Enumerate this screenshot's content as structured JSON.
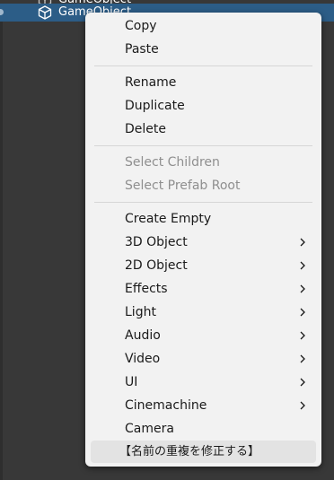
{
  "hierarchy": {
    "selected_object": "GameObject",
    "previous_object": "GameObject"
  },
  "context_menu": {
    "copy": "Copy",
    "paste": "Paste",
    "rename": "Rename",
    "duplicate": "Duplicate",
    "delete": "Delete",
    "select_children": "Select Children",
    "select_prefab_root": "Select Prefab Root",
    "create_empty": "Create Empty",
    "object_3d": "3D Object",
    "object_2d": "2D Object",
    "effects": "Effects",
    "light": "Light",
    "audio": "Audio",
    "video": "Video",
    "ui": "UI",
    "cinemachine": "Cinemachine",
    "camera": "Camera",
    "fix_duplicate_names": "【名前の重複を修正する】"
  },
  "colors": {
    "menu_background": "#f2f2f2",
    "selection_highlight": "#2c5d87",
    "hover_highlight": "#e3e3e3",
    "disabled_text": "#8f8f8f"
  },
  "icons": {
    "game_object": "cube-icon",
    "submenu": "chevron-right-icon"
  }
}
